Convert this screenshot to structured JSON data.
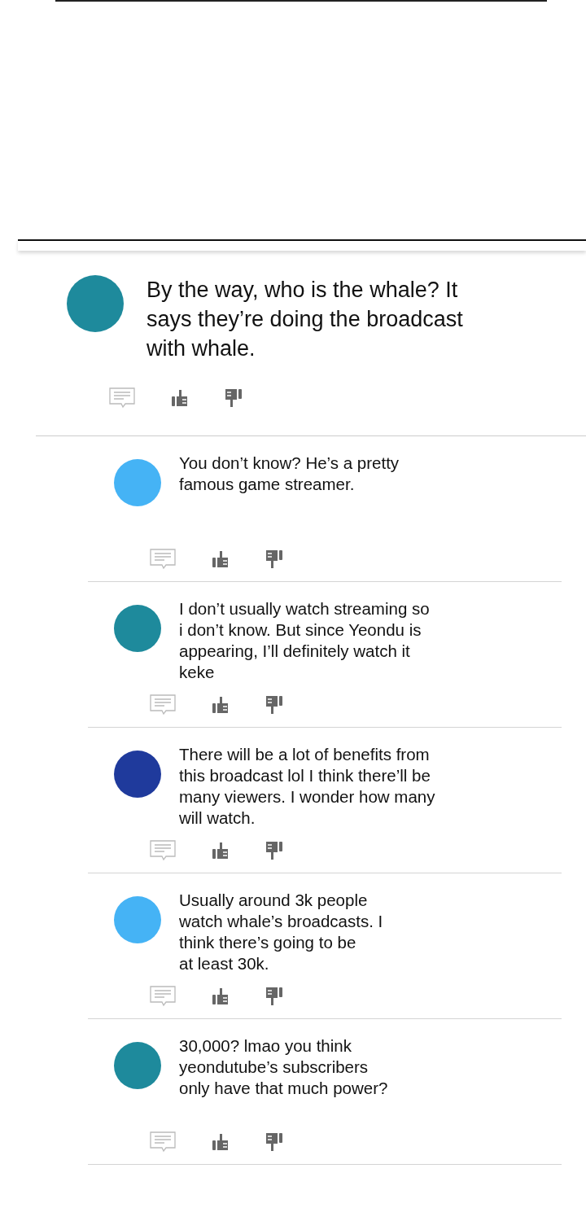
{
  "comment": {
    "color": "#1e8a9c",
    "text": "By the way, who is the whale? It\nsays they’re doing the broadcast\nwith whale."
  },
  "replies": [
    {
      "color": "#45b3f5",
      "text": "You don’t know? He’s a pretty\nfamous game streamer."
    },
    {
      "color": "#1e8a9c",
      "text": "I don’t usually watch streaming so\ni don’t know. But since Yeondu is\nappearing, I’ll definitely watch it\nkeke"
    },
    {
      "color": "#1f3a9c",
      "text": "There will be a lot of benefits from\nthis broadcast lol I think there’ll be\nmany viewers. I wonder how many\nwill watch."
    },
    {
      "color": "#45b3f5",
      "text": "Usually around 3k people\nwatch whale’s broadcasts. I\nthink there’s going to be\nat least 30k."
    },
    {
      "color": "#1e8a9c",
      "text": "30,000? lmao you think\nyeondutube’s subscribers\nonly have that much power?"
    }
  ]
}
